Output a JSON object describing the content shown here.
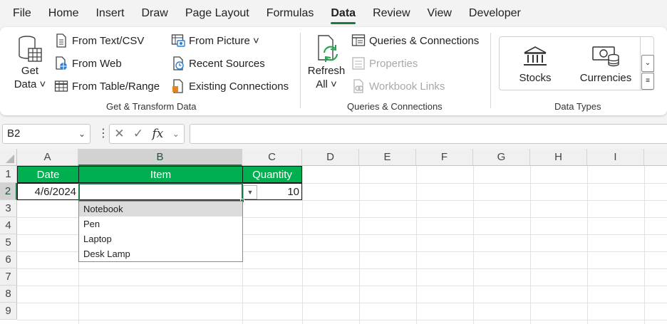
{
  "menu": [
    "File",
    "Home",
    "Insert",
    "Draw",
    "Page Layout",
    "Formulas",
    "Data",
    "Review",
    "View",
    "Developer"
  ],
  "active_menu": "Data",
  "ribbon": {
    "get_transform": {
      "get_data_line1": "Get",
      "get_data_line2": "Data ˅",
      "from_text_csv": "From Text/CSV",
      "from_web": "From Web",
      "from_table_range": "From Table/Range",
      "from_picture": "From Picture ˅",
      "recent_sources": "Recent Sources",
      "existing_connections": "Existing Connections",
      "label": "Get & Transform Data"
    },
    "queries": {
      "refresh_line1": "Refresh",
      "refresh_line2": "All ˅",
      "queries_connections": "Queries & Connections",
      "properties": "Properties",
      "workbook_links": "Workbook Links",
      "label": "Queries & Connections"
    },
    "data_types": {
      "stocks": "Stocks",
      "currencies": "Currencies",
      "label": "Data Types"
    }
  },
  "formula_bar": {
    "name_box": "B2",
    "fx": "fx",
    "formula": ""
  },
  "columns": [
    "A",
    "B",
    "C",
    "D",
    "E",
    "F",
    "G",
    "H",
    "I"
  ],
  "rows": [
    "1",
    "2",
    "3",
    "4",
    "5",
    "6",
    "7",
    "8",
    "9"
  ],
  "table": {
    "headers": [
      "Date",
      "Item",
      "Quantity"
    ],
    "row1": [
      "4/6/2024",
      "",
      "10"
    ]
  },
  "dropdown_options": [
    "Notebook",
    "Pen",
    "Laptop",
    "Desk Lamp"
  ],
  "colors": {
    "accent": "#1a7a43",
    "header_fill": "#00b050"
  }
}
